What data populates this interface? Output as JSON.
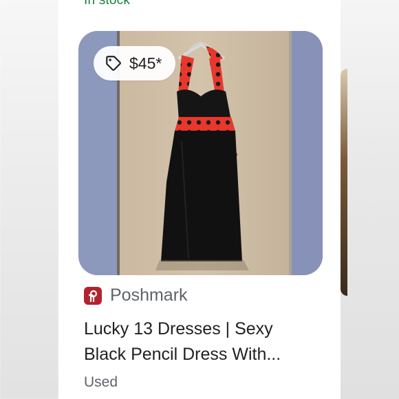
{
  "listing": {
    "stock_status": "In stock",
    "price": "$45*",
    "merchant": "Poshmark",
    "title_line1": "Lucky 13 Dresses | Sexy",
    "title_line2": "Black Pencil Dress With...",
    "condition": "Used",
    "product_image_alt": "Black halter pencil dress with red polka dot trim on a hanger"
  },
  "colors": {
    "stock_green": "#188038",
    "merchant_brand": "#b3232f",
    "text_primary": "#202124",
    "text_secondary": "#5f6368"
  },
  "icons": {
    "price_tag": "tag-icon",
    "merchant_logo": "poshmark-logo-icon"
  }
}
